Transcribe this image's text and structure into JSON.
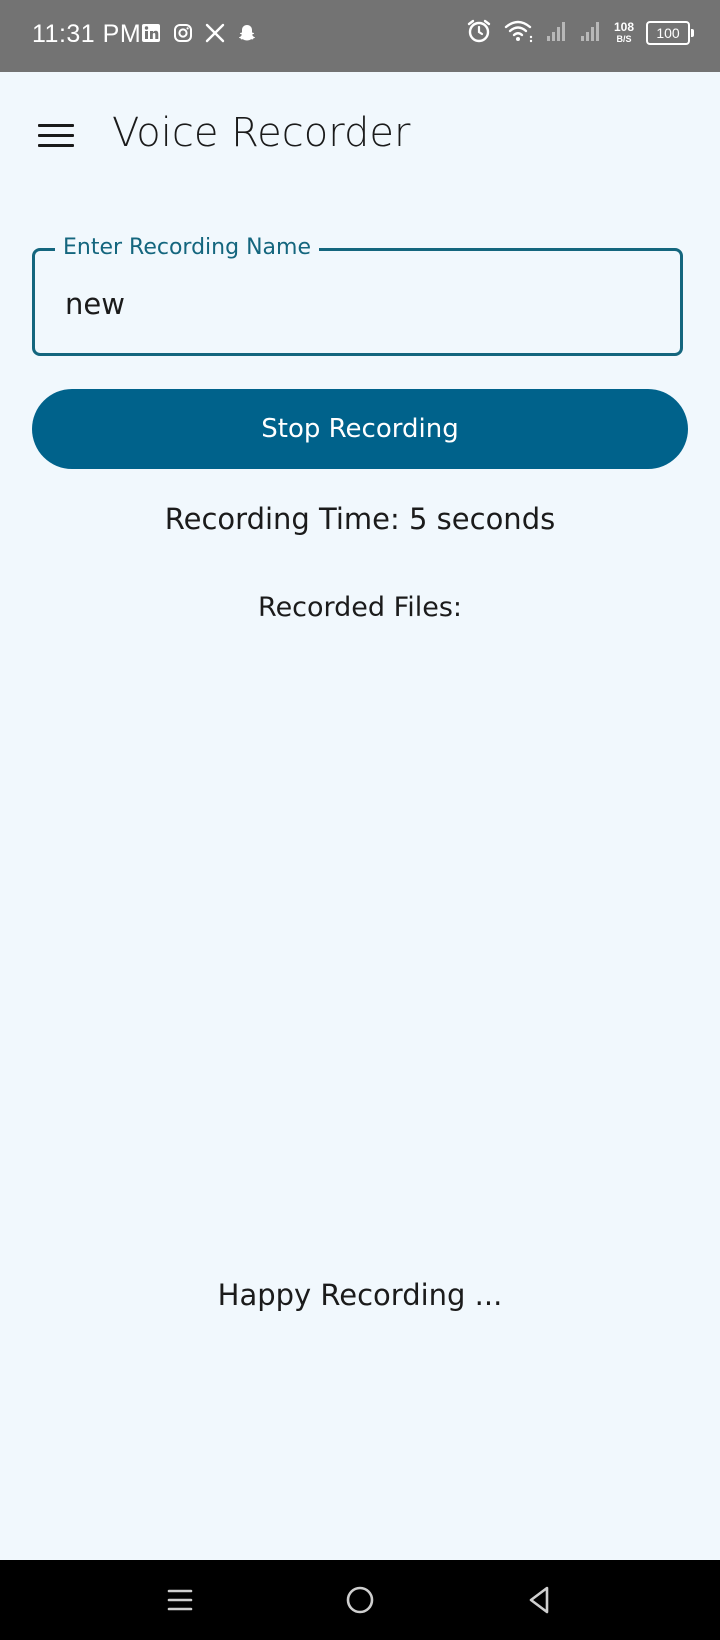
{
  "status_bar": {
    "time": "11:31 PM",
    "app_icons": [
      "linkedin-icon",
      "instagram-icon",
      "x-icon",
      "snapchat-icon"
    ],
    "net_speed_value": "108",
    "net_speed_unit": "B/S",
    "battery_level": "100"
  },
  "app_bar": {
    "title": "Voice Recorder",
    "menu_icon": "hamburger-menu-icon"
  },
  "form": {
    "name_label": "Enter Recording Name",
    "name_value": "new",
    "stop_button_label": "Stop Recording"
  },
  "status": {
    "recording_time": "Recording Time: 5 seconds",
    "recorded_files_heading": "Recorded Files:"
  },
  "recorded_files": [],
  "footer": {
    "message": "Happy Recording ..."
  },
  "nav_bar": {
    "buttons": [
      "recents-icon",
      "home-icon",
      "back-icon"
    ]
  },
  "colors": {
    "primary": "#00628b",
    "field_border": "#14667e",
    "background": "#f1f8fd",
    "status_bar": "#737373"
  }
}
